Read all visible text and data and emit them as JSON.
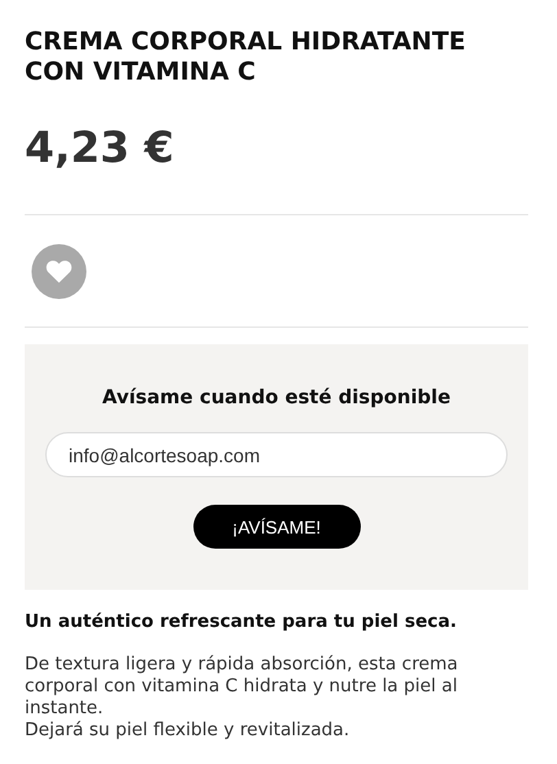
{
  "product": {
    "title": "CREMA CORPORAL HIDRATANTE CON VITAMINA C",
    "price": "4,23 €",
    "favorite": false
  },
  "notify": {
    "heading": "Avísame cuando esté disponible",
    "email": "info@alcortesoap.com",
    "button": "¡AVÍSAME!"
  },
  "description": {
    "tagline": "Un auténtico refrescante para tu piel seca.",
    "lines": [
      "De textura ligera y rápida absorción, esta crema corporal con vitamina C hidrata y nutre la piel al instante.",
      "Dejará su piel flexible y revitalizada."
    ]
  }
}
